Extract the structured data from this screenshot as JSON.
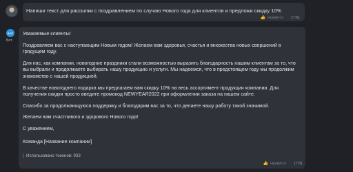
{
  "user_message": {
    "text": "Напиши текст для рассылки с поздравлением по случаю Нового года для клиентов и предложи скидку 10%",
    "like_label": "Нравится",
    "time": "17:51"
  },
  "bot": {
    "name": "Бот",
    "avatar_text": "БОТ",
    "paragraphs": [
      "Уважаемые клиенты!",
      "Поздравляем вас с наступающим Новым годом! Желаем вам здоровья, счастья и множества новых свершений в грядущем году.",
      "Для нас, как компании, новогодние праздники стали возможностью выразить благодарность нашим клиентам за то, что вы выбрали и продолжаете выбирать нашу продукцию и услуги. Мы надеемся, что в предстоящем году мы продолжим знакомство с нашей продукцией.",
      "В качестве новогоднего подарка мы предлагаем вам скидку 10% на весь ассортимент продукции компании. Для получения скидки просто введите промокод NEWYEAR2022 при оформлении заказа на нашем сайте.",
      "Спасибо за продолжающуюся поддержку и благодарим вас за то, что делаете нашу работу такой значимой.",
      "Желаем вам счастливого и здорового Нового года!",
      "С уважением,\n\nКоманда [Название компании]"
    ],
    "tokens_text": "Использовано токенов: 933",
    "like_label": "Нравится",
    "time": "17:51"
  },
  "icons": {
    "like": "thumbs-up-icon"
  }
}
